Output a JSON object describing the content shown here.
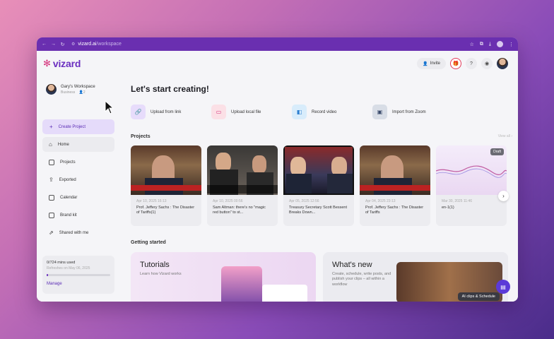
{
  "browser": {
    "url_host": "vizard.ai",
    "url_path": "/workspace"
  },
  "logo": {
    "text": "vizard"
  },
  "workspace": {
    "name": "Gary's Workspace",
    "plan": "Business",
    "members": "2"
  },
  "sidebar": {
    "create": "Create Project",
    "items": [
      {
        "label": "Home"
      },
      {
        "label": "Projects"
      },
      {
        "label": "Exported"
      },
      {
        "label": "Calendar"
      },
      {
        "label": "Brand kit"
      },
      {
        "label": "Shared with me"
      }
    ],
    "usage": {
      "title": "0/724 mins used",
      "sub": "Refreshes on May 06, 2025",
      "progress": 0.02,
      "link": "Manage"
    }
  },
  "top": {
    "invite": "Invite"
  },
  "main": {
    "heading": "Let's start creating!",
    "actions": [
      {
        "label": "Upload from link",
        "color": "#e7dcfb"
      },
      {
        "label": "Upload local file",
        "color": "#fbe0e6"
      },
      {
        "label": "Record video",
        "color": "#d8ecfb"
      },
      {
        "label": "Import from Zoom",
        "color": "#d8dde6"
      }
    ],
    "projects_title": "Projects",
    "view_all": "View all",
    "projects": [
      {
        "date": "Apr 10, 2025 16:13",
        "title": "Prof. Jeffery Sachs : The Disaster of Tariffs(1)"
      },
      {
        "date": "Apr 10, 2025 00:56",
        "title": "Sam Altman: there's no \"magic red button\" to st..."
      },
      {
        "date": "Apr 05, 2025 12:56",
        "title": "Treasury Secretary Scott Bessent Breaks Down..."
      },
      {
        "date": "Apr 04, 2025 23:13",
        "title": "Prof. Jeffery Sachs : The Disaster of Tariffs"
      },
      {
        "date": "Mar 30, 2025 11:46",
        "title": "en-1(1)",
        "badge": "Draft"
      }
    ],
    "getting_started": "Getting started",
    "tutorials": {
      "title": "Tutorials",
      "sub": "Learn how Vizard works"
    },
    "whats_new": {
      "title": "What's new",
      "sub": "Create, schedule, write posts, and publish your clips – all within a workflow",
      "chip": "AI clips & Schedule"
    }
  }
}
